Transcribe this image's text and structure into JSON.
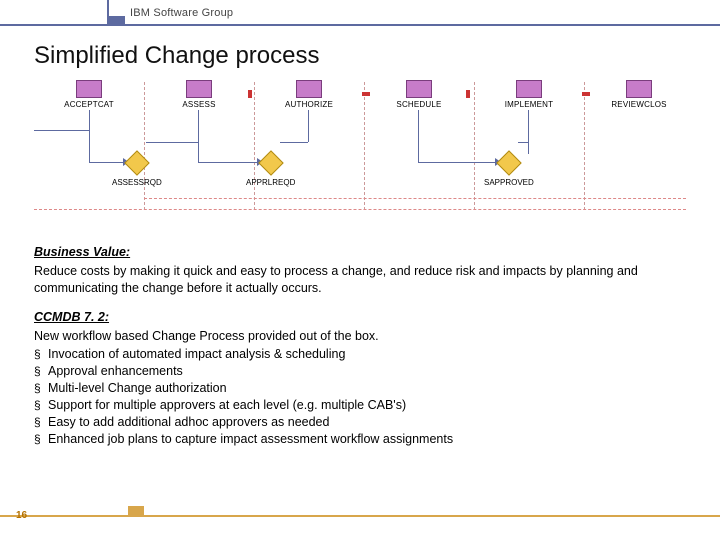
{
  "header": {
    "group": "IBM Software Group"
  },
  "title": "Simplified Change process",
  "diagram": {
    "stages": [
      {
        "label": "ACCEPTCAT"
      },
      {
        "label": "ASSESS"
      },
      {
        "label": "AUTHORIZE"
      },
      {
        "label": "SCHEDULE"
      },
      {
        "label": "IMPLEMENT"
      },
      {
        "label": "REVIEWCLOS"
      }
    ],
    "decisions": [
      {
        "label": "ASSESSRQD"
      },
      {
        "label": "APPRLREQD"
      },
      {
        "label": "SAPPROVED"
      }
    ]
  },
  "business_value": {
    "heading": "Business Value:",
    "text": "Reduce costs by making it quick and easy to process a change, and reduce risk and impacts by planning and communicating the change before it actually occurs."
  },
  "ccmdb": {
    "heading": "CCMDB 7. 2:",
    "intro": "New workflow based Change Process provided out of the box.",
    "features": [
      "Invocation of automated impact analysis & scheduling",
      "Approval enhancements",
      "Multi-level Change authorization",
      "Support for multiple approvers at each level (e.g. multiple CAB's)",
      "Easy to add additional adhoc approvers as needed",
      "Enhanced job plans to capture impact assessment workflow assignments"
    ]
  },
  "footer": {
    "page": "16"
  }
}
